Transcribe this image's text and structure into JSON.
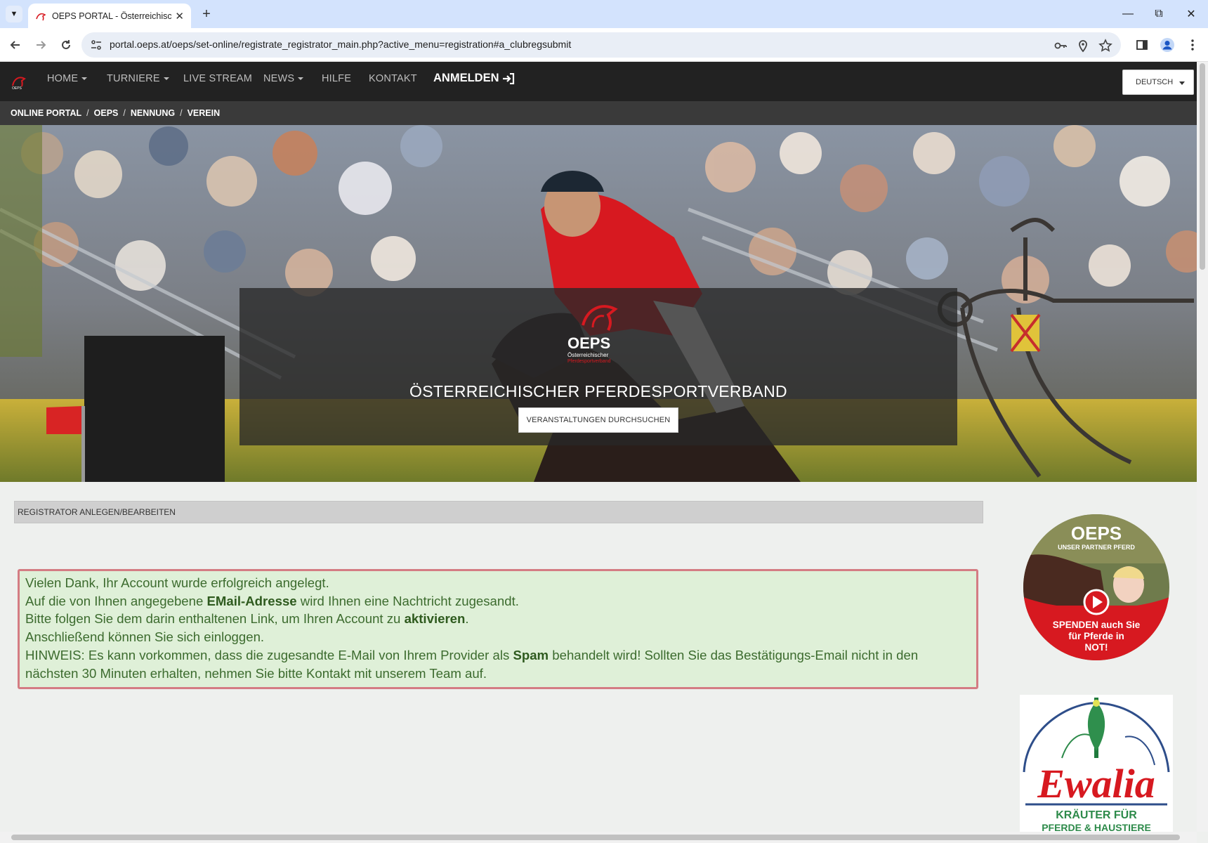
{
  "browser": {
    "tab_title": "OEPS PORTAL - Österreichischer",
    "url": "portal.oeps.at/oeps/set-online/registrate_registrator_main.php?active_menu=registration#a_clubregsubmit"
  },
  "nav": {
    "items": [
      {
        "label": "HOME",
        "dropdown": true
      },
      {
        "label": "TURNIERE",
        "dropdown": true
      },
      {
        "label": "LIVE STREAM",
        "dropdown": false
      },
      {
        "label": "NEWS",
        "dropdown": true
      },
      {
        "label": "HILFE",
        "dropdown": false
      },
      {
        "label": "KONTAKT",
        "dropdown": false
      }
    ],
    "login_label": "ANMELDEN",
    "language": "DEUTSCH"
  },
  "breadcrumb": [
    "ONLINE PORTAL",
    "OEPS",
    "NENNUNG",
    "VEREIN"
  ],
  "hero": {
    "logo_text": "OEPS",
    "logo_sub1": "Österreichischer",
    "logo_sub2": "Pferdesportverband",
    "title": "ÖSTERREICHISCHER PFERDESPORTVERBAND",
    "button_label": "VERANSTALTUNGEN DURCHSUCHEN"
  },
  "section": {
    "title": "REGISTRATOR ANLEGEN/BEARBEITEN"
  },
  "alert": {
    "line1": "Vielen Dank, Ihr Account wurde erfolgreich angelegt.",
    "line2_pre": "Auf die von Ihnen angegebene ",
    "line2_bold": "EMail-Adresse",
    "line2_post": " wird Ihnen eine Nachtricht zugesandt.",
    "line3_pre": "Bitte folgen Sie dem darin enthaltenen Link, um Ihren Account zu ",
    "line3_bold": "aktivieren",
    "line3_post": ".",
    "line4": "Anschließend können Sie sich einloggen.",
    "line5_pre": "HINWEIS: Es kann vorkommen, dass die zugesandte E-Mail von Ihrem Provider als ",
    "line5_bold": "Spam",
    "line5_post": " behandelt wird! Sollten Sie das Bestätigungs-Email nicht in den nächsten 30 Minuten erhalten, nehmen Sie bitte Kontakt mit unserem Team auf."
  },
  "ads": {
    "oeps": {
      "logo": "OEPS",
      "tagline": "UNSER PARTNER PFERD",
      "line1": "SPENDEN auch Sie",
      "line2": "für Pferde in",
      "line3": "NOT!"
    },
    "ewalia": {
      "brand": "Ewalia",
      "line1": "KRÄUTER FÜR",
      "line2": "PFERDE & HAUSTIERE"
    }
  },
  "colors": {
    "nav_bg": "#222222",
    "breadcrumb_bg": "#3a3a3a",
    "alert_bg": "#dff0d8",
    "alert_border": "#d47c83",
    "alert_text": "#3c6b2e",
    "brand_red": "#d71920"
  },
  "icons": [
    "tab-list-icon",
    "favicon-icon",
    "close-icon",
    "plus-icon",
    "back-icon",
    "forward-icon",
    "reload-icon",
    "site-settings-icon",
    "password-key-icon",
    "location-icon",
    "star-icon",
    "side-panel-icon",
    "profile-icon",
    "more-icon",
    "login-icon",
    "caret-down-icon",
    "play-icon"
  ]
}
